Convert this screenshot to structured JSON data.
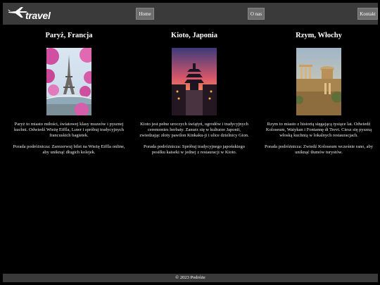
{
  "header": {
    "logo_text": "travel",
    "nav": {
      "home": "Home",
      "about": "O nas",
      "contact": "Kontakt"
    }
  },
  "destinations": [
    {
      "title": "Paryż, Francja",
      "description": "Paryż to miasto miłości, światowej klasy muzeów i pysznej kuchni. Odwiedź Wieżę Eiffla, Luwr i spróbuj tradycyjnych francuskich bagietek.",
      "tip": "Porada podróżnicza: Zarezerwuj bilet na Wieżę Eiffla online, aby uniknąć długich kolejek."
    },
    {
      "title": "Kioto, Japonia",
      "description": "Kioto jest pełne uroczych świątyń, ogrodów i tradycyjnych ceremonies herbaty. Zanurz się w kulturze Japonii, zwiedzając złoty pawilon Kinkaku-ji i ulice dzielnicy Gion.",
      "tip": "Porada podróżnicza: Spróbuj tradycyjnego japońskiego posiłku kaiseki w jednej z restauracji w Kioto."
    },
    {
      "title": "Rzym, Włochy",
      "description": "Rzym to miasto z historią sięgającą tysiące lat. Odwiedź Koloseum, Watykan i Fontannę di Trevi. Ciesz się pyszną włoską kuchnią w lokalnych restauracjach.",
      "tip": "Porada podróżnicza: Zwiedź Koloseum wcześnie rano, aby uniknąć tłumów turystów."
    }
  ],
  "footer": {
    "text": "© 2023 Podróże"
  },
  "colors": {
    "background": "#000000",
    "header_bar": "#3a3a3a",
    "nav_button": "#6e6e6e",
    "text": "#ffffff"
  }
}
